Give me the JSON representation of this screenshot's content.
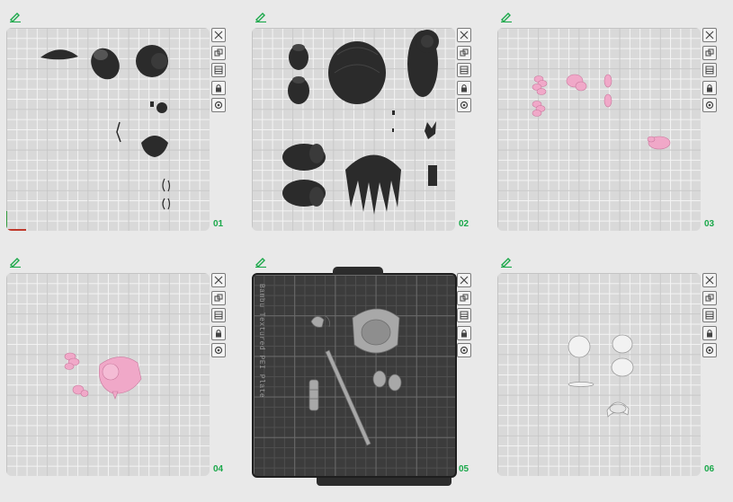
{
  "colors": {
    "background": "#e9e9e9",
    "plate": "#d9d9d9",
    "dark_plate": "#3c3c3c",
    "plate_number": "#1aa84a",
    "edit_icon": "#1aa84a",
    "part_dark": "#2b2b2b",
    "part_pink": "#f0a8c8",
    "part_white": "#f2f2f2",
    "part_gray": "#9e9e9e"
  },
  "toolbar": {
    "buttons": [
      "close-icon",
      "auto-arrange-icon",
      "orient-icon",
      "lock-icon",
      "settings-icon"
    ]
  },
  "plates": [
    {
      "number": "01",
      "style": "light",
      "part_color": "dark"
    },
    {
      "number": "02",
      "style": "light",
      "part_color": "dark"
    },
    {
      "number": "03",
      "style": "light",
      "part_color": "pink"
    },
    {
      "number": "04",
      "style": "light",
      "part_color": "pink"
    },
    {
      "number": "05",
      "style": "dark",
      "part_color": "gray",
      "label": "Bambu Textured PEI Plate"
    },
    {
      "number": "06",
      "style": "light",
      "part_color": "white"
    }
  ]
}
